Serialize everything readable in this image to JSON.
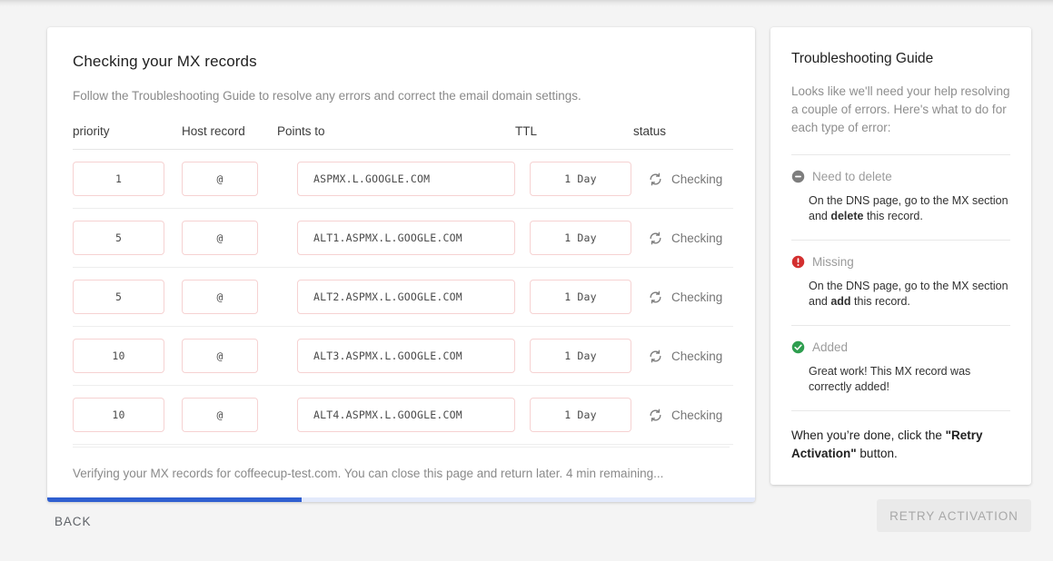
{
  "main": {
    "title": "Checking your MX records",
    "subtitle": "Follow the Troubleshooting Guide to resolve any errors and correct the email domain settings.",
    "columns": {
      "priority": "priority",
      "host": "Host record",
      "points_to": "Points to",
      "ttl": "TTL",
      "status": "status"
    },
    "rows": [
      {
        "priority": "1",
        "host": "@",
        "points_to": "ASPMX.L.GOOGLE.COM",
        "ttl": "1 Day",
        "status": "Checking",
        "status_icon": "sync-icon"
      },
      {
        "priority": "5",
        "host": "@",
        "points_to": "ALT1.ASPMX.L.GOOGLE.COM",
        "ttl": "1 Day",
        "status": "Checking",
        "status_icon": "sync-icon"
      },
      {
        "priority": "5",
        "host": "@",
        "points_to": "ALT2.ASPMX.L.GOOGLE.COM",
        "ttl": "1 Day",
        "status": "Checking",
        "status_icon": "sync-icon"
      },
      {
        "priority": "10",
        "host": "@",
        "points_to": "ALT3.ASPMX.L.GOOGLE.COM",
        "ttl": "1 Day",
        "status": "Checking",
        "status_icon": "sync-icon"
      },
      {
        "priority": "10",
        "host": "@",
        "points_to": "ALT4.ASPMX.L.GOOGLE.COM",
        "ttl": "1 Day",
        "status": "Checking",
        "status_icon": "sync-icon"
      }
    ],
    "verify_text": "Verifying your MX records for coffeecup-test.com. You can close this page and return later. 4 min remaining...",
    "progress_percent": 36
  },
  "guide": {
    "title": "Troubleshooting Guide",
    "intro": "Looks like we'll need your help resolving a couple of errors. Here's what to do for each type of error:",
    "legend": [
      {
        "name": "Need to delete",
        "icon": "minus-circle-icon",
        "color": "#7d7d7d",
        "body_before": "On the DNS page, go to the MX section and ",
        "body_bold": "delete",
        "body_after": " this record."
      },
      {
        "name": "Missing",
        "icon": "error-circle-icon",
        "color": "#d32f2f",
        "body_before": "On the DNS page, go to the MX section and ",
        "body_bold": "add",
        "body_after": " this record."
      },
      {
        "name": "Added",
        "icon": "check-circle-icon",
        "color": "#2e9e4f",
        "body_before": "Great work! This MX record was correctly added!",
        "body_bold": "",
        "body_after": ""
      }
    ],
    "final_note_before": "When you’re done, click the ",
    "final_note_bold": "\"Retry Activation\"",
    "final_note_after": " button."
  },
  "actions": {
    "back_label": "BACK",
    "retry_label": "RETRY ACTIVATION"
  },
  "colors": {
    "progress_fill": "#2f5fd0",
    "progress_track": "#e3eafb",
    "field_border": "#f6d2d2",
    "page_background": "#f4f4f4"
  }
}
